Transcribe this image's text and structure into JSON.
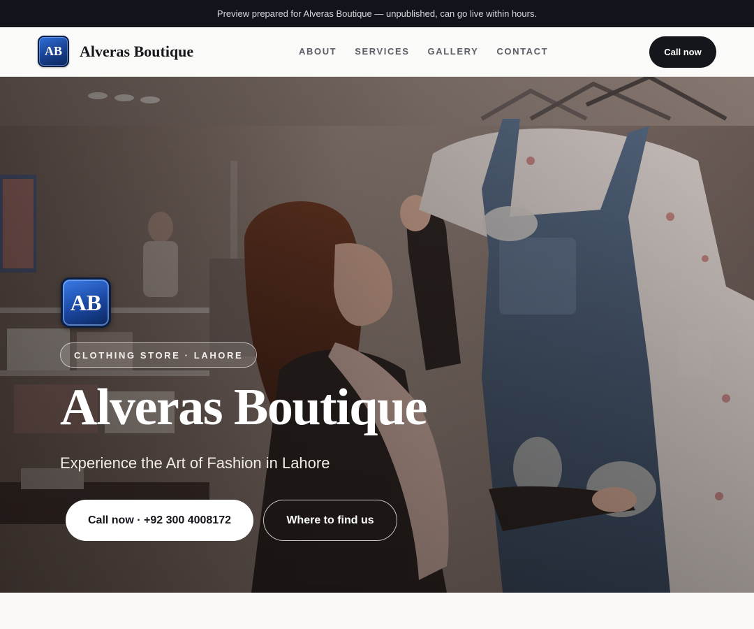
{
  "preview_bar": {
    "text": "Preview prepared for Alveras Boutique — unpublished, can go live within hours."
  },
  "header": {
    "logo_text": "AB",
    "brand_name": "Alveras Boutique",
    "nav": [
      "ABOUT",
      "SERVICES",
      "GALLERY",
      "CONTACT"
    ],
    "cta_label": "Call now"
  },
  "hero": {
    "logo_text": "AB",
    "tag": "CLOTHING STORE · LAHORE",
    "title": "Alveras Boutique",
    "subtitle": "Experience the Art of Fashion in Lahore",
    "primary_button": "Call now · +92 300 4008172",
    "secondary_button": "Where to find us",
    "photo_icon": "boutique-shopper-photo"
  },
  "colors": {
    "dark": "#11141a",
    "logo_blue": "#1a47a0",
    "page_bg": "#faf9f6"
  }
}
